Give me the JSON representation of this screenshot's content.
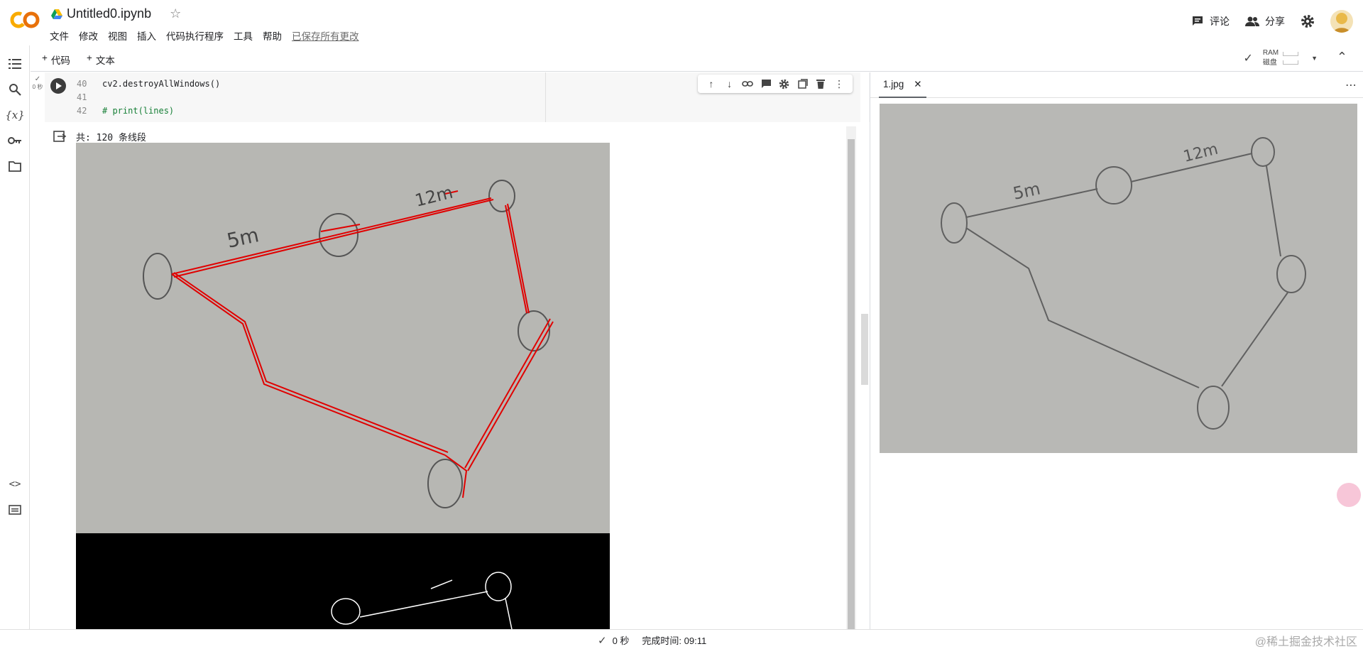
{
  "header": {
    "title": "Untitled0.ipynb",
    "menu": [
      "文件",
      "修改",
      "视图",
      "插入",
      "代码执行程序",
      "工具",
      "帮助"
    ],
    "saved_status": "已保存所有更改",
    "comment_label": "评论",
    "share_label": "分享"
  },
  "toolbar": {
    "add_code": "代码",
    "add_text": "文本",
    "ram_label": "RAM",
    "disk_label": "磁盘"
  },
  "cell": {
    "exec_time": "0 秒",
    "lines": [
      {
        "num": "40",
        "code": "cv2.destroyAllWindows()"
      },
      {
        "num": "41",
        "code": ""
      },
      {
        "num": "42",
        "code": "#  print(lines)"
      }
    ]
  },
  "output": {
    "text": "共: 120 条线段",
    "img1_annotations": [
      "5m",
      "12m"
    ]
  },
  "panel": {
    "tab_name": "1.jpg",
    "annotations": [
      "5m",
      "12m"
    ]
  },
  "status": {
    "elapsed": "0 秒",
    "completed_label": "完成时间: 09:11",
    "watermark": "@稀土掘金技术社区"
  },
  "colors": {
    "accent_orange": "#F9AB00",
    "detected_lines": "#e00000"
  }
}
